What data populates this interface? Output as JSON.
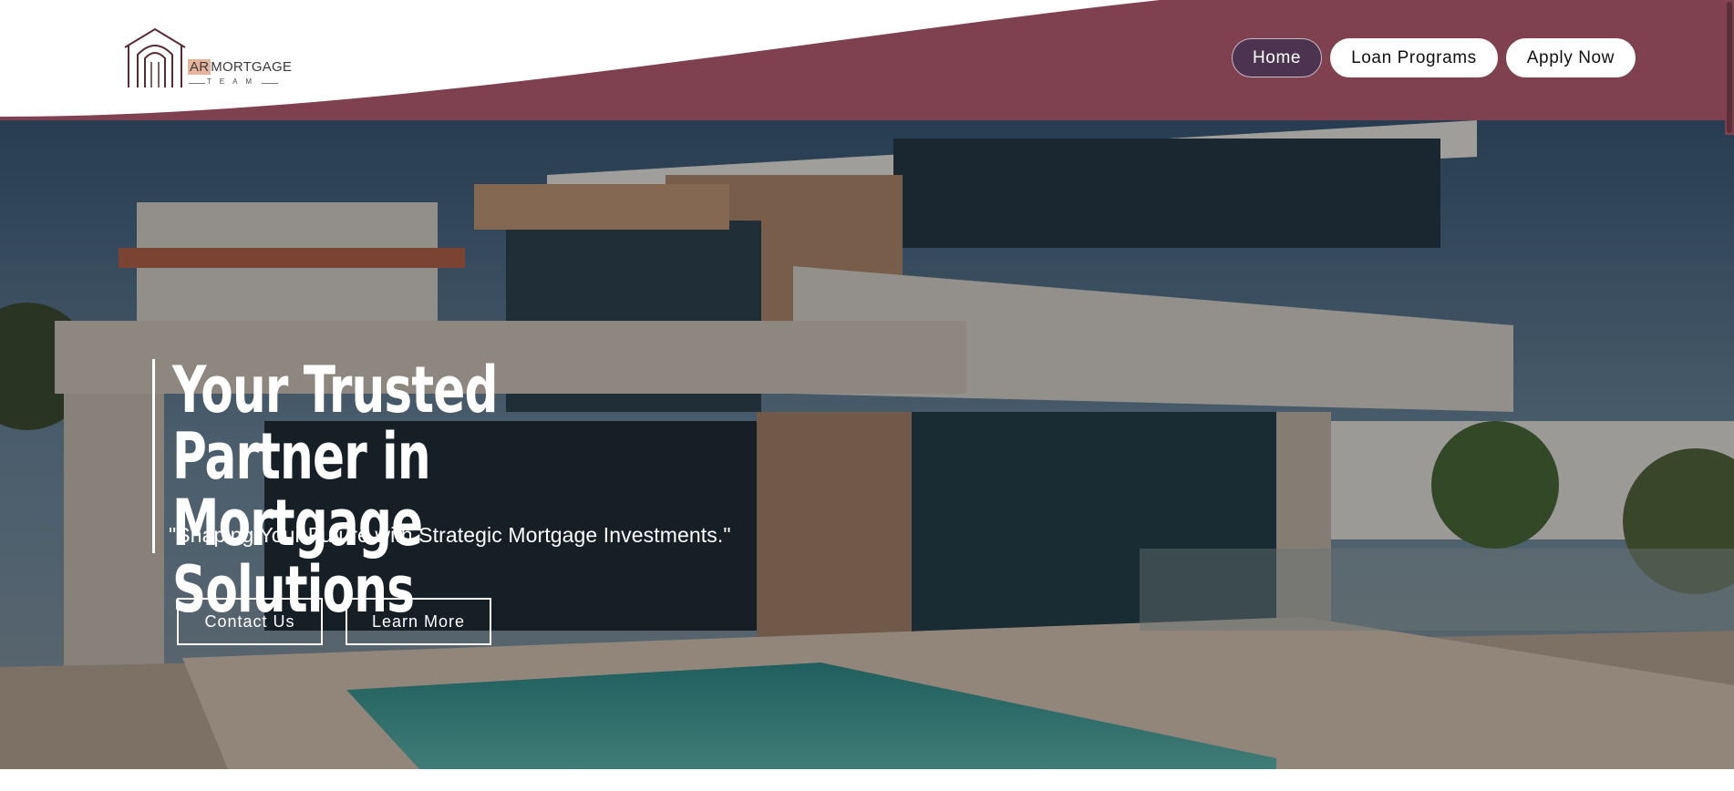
{
  "brand": {
    "logo_prefix": "AR",
    "logo_word": "MORTGAGE",
    "logo_sub": "TEAM"
  },
  "nav": {
    "items": [
      {
        "label": "Home",
        "active": true
      },
      {
        "label": "Loan Programs",
        "active": false
      },
      {
        "label": "Apply Now",
        "active": false
      }
    ]
  },
  "hero": {
    "title_line1": "Your Trusted Partner in",
    "title_line2": "Mortgage Solutions",
    "subtitle": "\"Shaping Your Future with Strategic Mortgage Investments.\"",
    "primary_button": "Contact Us",
    "secondary_button": "Learn More",
    "background_image": "modern-house-with-pool"
  },
  "colors": {
    "brand_maroon": "#7f414f",
    "active_nav": "#4c3350",
    "logo_accent": "#e6b49a"
  }
}
